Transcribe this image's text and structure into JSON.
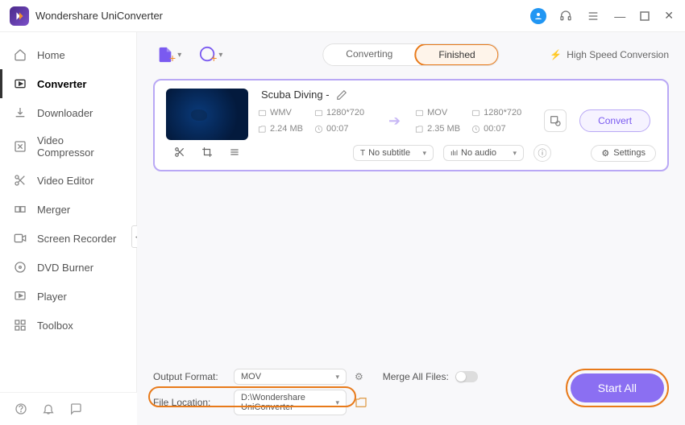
{
  "app": {
    "title": "Wondershare UniConverter"
  },
  "sidebar": {
    "items": [
      {
        "label": "Home"
      },
      {
        "label": "Converter"
      },
      {
        "label": "Downloader"
      },
      {
        "label": "Video Compressor"
      },
      {
        "label": "Video Editor"
      },
      {
        "label": "Merger"
      },
      {
        "label": "Screen Recorder"
      },
      {
        "label": "DVD Burner"
      },
      {
        "label": "Player"
      },
      {
        "label": "Toolbox"
      }
    ]
  },
  "tabs": {
    "converting": "Converting",
    "finished": "Finished"
  },
  "topbar": {
    "high_speed": "High Speed Conversion"
  },
  "item": {
    "title": "Scuba Diving -",
    "src": {
      "format": "WMV",
      "resolution": "1280*720",
      "size": "2.24 MB",
      "duration": "00:07"
    },
    "dst": {
      "format": "MOV",
      "resolution": "1280*720",
      "size": "2.35 MB",
      "duration": "00:07"
    },
    "subtitle": "No subtitle",
    "audio": "No audio",
    "settings_label": "Settings",
    "convert_label": "Convert"
  },
  "bottom": {
    "output_format_label": "Output Format:",
    "output_format_value": "MOV",
    "file_location_label": "File Location:",
    "file_location_value": "D:\\Wondershare UniConverter",
    "merge_label": "Merge All Files:",
    "start_label": "Start All"
  }
}
